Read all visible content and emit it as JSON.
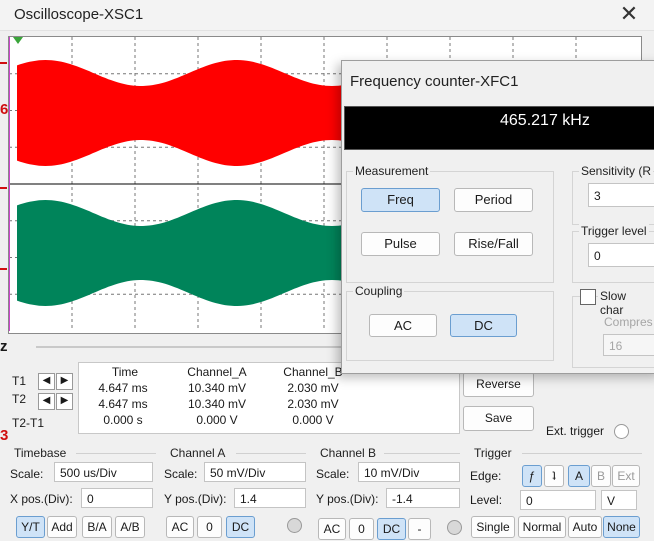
{
  "oscilloscope": {
    "title": "Oscilloscope-XSC1",
    "close_icon": "close-icon",
    "colors": {
      "channel_a": "#ff0000",
      "channel_b": "#00845a",
      "cursor": "#cc44cc"
    },
    "left_edge_marks": [
      "6",
      "3"
    ],
    "readout": {
      "headers": [
        "Time",
        "Channel_A",
        "Channel_B"
      ],
      "rows": [
        {
          "label": "T1",
          "time": "4.647 ms",
          "channel_a": "10.340 mV",
          "channel_b": "2.030 mV"
        },
        {
          "label": "T2",
          "time": "4.647 ms",
          "channel_a": "10.340 mV",
          "channel_b": "2.030 mV"
        },
        {
          "label": "T2-T1",
          "time": "0.000 s",
          "channel_a": "0.000 V",
          "channel_b": "0.000 V"
        }
      ]
    },
    "side_buttons": {
      "reverse": "Reverse",
      "save": "Save",
      "ext_trigger": "Ext. trigger"
    },
    "timebase": {
      "title": "Timebase",
      "scale_label": "Scale:",
      "scale_value": "500 us/Div",
      "xpos_label": "X pos.(Div):",
      "xpos_value": "0",
      "buttons": [
        "Y/T",
        "Add",
        "B/A",
        "A/B"
      ],
      "selected": "Y/T"
    },
    "channel_a": {
      "title": "Channel A",
      "scale_label": "Scale:",
      "scale_value": "50 mV/Div",
      "ypos_label": "Y pos.(Div):",
      "ypos_value": "1.4",
      "buttons": [
        "AC",
        "0",
        "DC"
      ],
      "selected": "DC"
    },
    "channel_b": {
      "title": "Channel B",
      "scale_label": "Scale:",
      "scale_value": "10 mV/Div",
      "ypos_label": "Y pos.(Div):",
      "ypos_value": "-1.4",
      "buttons": [
        "AC",
        "0",
        "DC",
        "-"
      ],
      "selected": "DC"
    },
    "trigger": {
      "title": "Trigger",
      "edge_label": "Edge:",
      "edge_buttons": [
        "A",
        "B",
        "Ext"
      ],
      "edge_selected": "A",
      "level_label": "Level:",
      "level_value": "0",
      "level_unit": "V",
      "mode_buttons": [
        "Single",
        "Normal",
        "Auto",
        "None"
      ],
      "mode_selected": "None"
    }
  },
  "frequency_counter": {
    "title": "Frequency counter-XFC1",
    "display_value": "465.217 kHz",
    "measurement": {
      "title": "Measurement",
      "buttons": [
        "Freq",
        "Period",
        "Pulse",
        "Rise/Fall"
      ],
      "selected": "Freq"
    },
    "coupling": {
      "title": "Coupling",
      "buttons": [
        "AC",
        "DC"
      ],
      "selected": "DC"
    },
    "sensitivity": {
      "label": "Sensitivity (R",
      "value": "3"
    },
    "trigger_level": {
      "label": "Trigger level",
      "value": "0"
    },
    "slow_change": {
      "label": "Slow char",
      "checked": false
    },
    "compress": {
      "label": "Compres",
      "value": "16"
    }
  }
}
